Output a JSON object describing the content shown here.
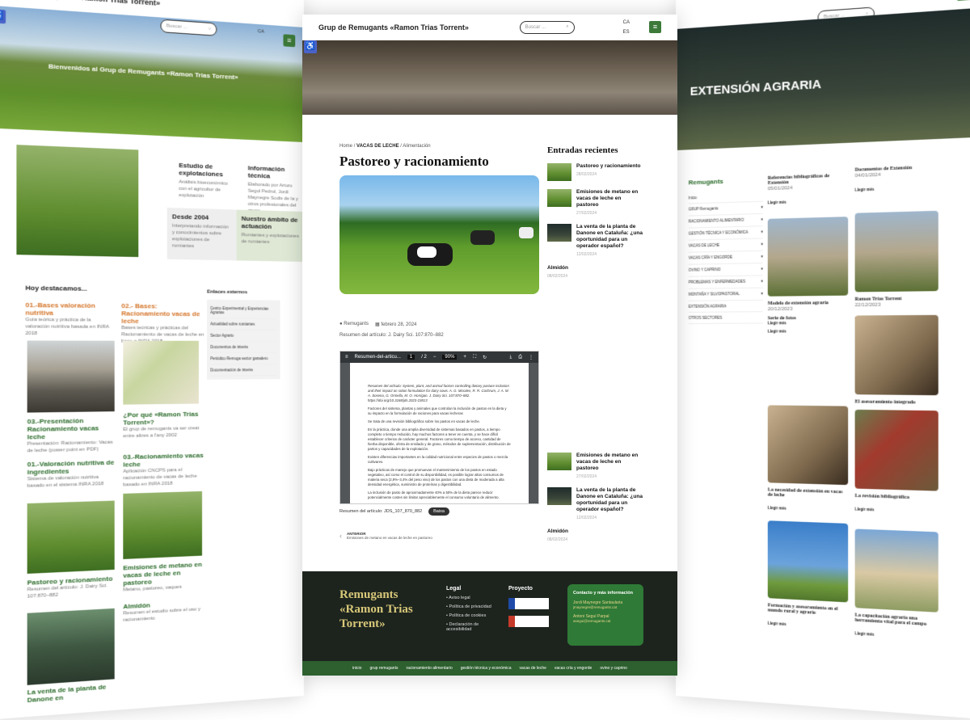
{
  "site": {
    "title": "Grup de Remugants «Ramon Trias Torrent»",
    "search_placeholder": "Buscar ...",
    "lang": "CA",
    "lang_alt": "ES",
    "accent": "#3d7a3a"
  },
  "left": {
    "hero_text": "Bienvenidos al Grup de Remugants «Ramon Trias Torrent»",
    "features": [
      {
        "title": "Estudio de explotaciones",
        "text": "Análisis bioeconómico con el agricultor de explotación"
      },
      {
        "title": "Información técnica",
        "text": "Elaborado por Arturo Segul Pedrol, Jordi Maynegre Sodis de la y otros profesionales del grupo"
      },
      {
        "title": "Desde 2004",
        "text": "Interpretando información y conocimientos sobre explotaciones de rumiantes"
      },
      {
        "title": "Nuestro ámbito de actuación",
        "text": "Rumiantes y explotaciones de rumiantes"
      }
    ],
    "highlights_title": "Hoy destacamos...",
    "links_title": "Enlaces externos",
    "ext_links": [
      "Centro Experimental y Experiencias Agrarias",
      "Actualidad sobre rumiantes",
      "Sector Agrario",
      "Documentos de interés",
      "Periódico Remuga sector ganadero",
      "Documentación de interés"
    ],
    "cards": [
      {
        "title": "01.-Bases valoración nutritiva",
        "text": "Guía teórica y práctica de la valoración nutritiva basada en INRA 2018"
      },
      {
        "title": "02.- Bases: Racionamiento vacas de leche",
        "text": "Bases teóricas y prácticas del Racionamiento de vacas de leche en base a INRA 2018"
      },
      {
        "title": "03.-Presentación Racionamiento vacas leche",
        "text": "Presentación: Racionamiento: Vacas de leche (power point en PDF)"
      },
      {
        "title": "¿Por qué «Ramon Trias Torrent»?",
        "text": "El grup de remugants va ser creat entre altres a l'any 2002"
      },
      {
        "title": "01.-Valoración nutritiva de ingredientes",
        "text": "Sistema de valoración nutritiva basado en el sistema INRA 2018"
      },
      {
        "title": "03.-Racionamiento vacas leche",
        "text": "Aplicación CNCPS para el racionamiento de vacas de leche basado en INRA 2018"
      },
      {
        "title": "Pastoreo y racionamiento",
        "text": "Resumen del artículo: J. Dairy Sci. 107:870–882"
      },
      {
        "title": "Emisiones de metano en vacas de leche en pastoreo",
        "text": "Metano, pastoreo, vaques"
      },
      {
        "title": "Almidón",
        "text": "Resumen el estudio sobre el uso y racionamiento"
      },
      {
        "title": "La venta de la planta de Danone en",
        "text": ""
      }
    ]
  },
  "center": {
    "breadcrumb": {
      "home": "Home",
      "sep": "/",
      "cat": "VACAS DE LECHE",
      "sub": "Alimentación"
    },
    "post_title": "Pastoreo y racionamiento",
    "meta_author": "Remugants",
    "meta_date": "febrero 28, 2024",
    "summary": "Resumen del artículo: J. Dairy Sci. 107:870–882",
    "pdf": {
      "filename": "Resumen-del-articu...",
      "page": "1",
      "pages": "/ 2",
      "zoom": "90%",
      "paragraphs": [
        "Resumen del artículo: System, plant, and animal factors controlling dietary pasture inclusion and their impact on ration formulation for dairy cows. A. G. Morales, R. R. Cochrum, J. A. M. A. Sosena, G. Ormella, M. O. Horrigan. J. Dairy Sci. 107:870–882. https://doi.org/10.3168/jds.2023-23813",
        "Factores del sistema, plantas y animales que controlan la inclusión de pastos en la dieta y su impacto en la formulación de raciones para vacas lecheras",
        "Se trata de una revisión bibliográfica sobre los pastos en vacas de leche.",
        "En la práctica, donde una amplia diversidad de sistemas basados en pastos, a tiempo completo o tiempo reducido, hay muchos factores a tener en cuenta, y se hace difícil establecer criterios de carácter general. Factores como tiempo de acceso, cantidad de hierba disponible, oferta de ensilado y de grano, métodos de suplementación, distribución de partos y capacidades de la explotación.",
        "Existen diferencias importantes en la calidad nutricional entre especies de pastos o mezcla cultivares.",
        "Bajo prácticas de manejo que promuevan el mantenimiento de los pastos en estado vegetativo, así como el control de su disponibilidad, es posible lograr altos consumos de materia seca (2,9%–3,4% del peso vivo) de los pastos con una dieta de moderada a alta densidad energética, suministro de proteínas y digestibilidad.",
        "La inclusión de pasto de aproximadamente 40% a 50% de la dieta parece reducir potencialmente costes sin limitar apreciablemente el consumo voluntario de alimento."
      ]
    },
    "download_label": "Resumen del artículo: JDS_107_870_882",
    "download_btn": "Baixa",
    "prev_label": "ANTERIOR",
    "prev_title": "Emisiones de metano en vacas de leche en pastoreo",
    "recent_title": "Entradas recientes",
    "recent": [
      {
        "title": "Pastoreo y racionamiento",
        "date": "28/02/2024"
      },
      {
        "title": "Emisiones de metano en vacas de leche en pastoreo",
        "date": "27/02/2024"
      },
      {
        "title": "La venta de la planta de Danone en Cataluña: ¿una oportunidad para un operador español?",
        "date": "12/02/2024"
      },
      {
        "title": "Almidón",
        "date": "08/02/2024"
      }
    ],
    "recent_dup": [
      {
        "title": "Emisiones de metano en vacas de leche en pastoreo",
        "date": "27/02/2024"
      },
      {
        "title": "La venta de la planta de Danone en Cataluña: ¿una oportunidad para un operador español?",
        "date": "12/02/2024"
      },
      {
        "title": "Almidón",
        "date": "08/02/2024"
      }
    ],
    "footer": {
      "brand": "Remugants «Ramon Trias Torrent»",
      "legal_title": "Legal",
      "legal_links": [
        "Aviso legal",
        "Política de privacidad",
        "Política de cookies",
        "Declaración de accesibilidad"
      ],
      "project_title": "Proyecto",
      "contact_title": "Contacto y más información",
      "contacts": [
        {
          "name": "Jordi Maynegre Santaularia",
          "email": "jmaynegre@remugants.cat"
        },
        {
          "name": "Antoni Seguí Parpal",
          "email": "asegui@remugants.cat"
        }
      ],
      "nav": [
        "inicio",
        "grup remugants",
        "racionamiento alimentario",
        "gestión técnica y económica",
        "vacas de leche",
        "vacas cría y engorde",
        "ovino y caprino"
      ]
    }
  },
  "right": {
    "hero_text": "EXTENSIÓN AGRARIA",
    "sidebar_title": "Remugants",
    "sidebar_items": [
      "Inicio",
      "GRUP Remugants",
      "RACIONAMIENTO ALIMENTARIO",
      "GESTIÓN TÉCNICA Y ECONÓMICA",
      "VACAS DE LECHE",
      "VACAS CRÍA Y ENGORDE",
      "OVINO Y CAPRINO",
      "PROBLEMAS Y ENFERMEDADES",
      "MONTAÑA Y SILVOPASTORAL",
      "EXTENSIÓN AGRARIA",
      "OTROS SECTORES"
    ],
    "posts": [
      {
        "title": "Referencias bibliográficas de Extensión",
        "date": "05/01/2024",
        "more": "Llegir més"
      },
      {
        "title": "Documentos de Extensión",
        "date": "04/01/2024",
        "more": "Llegir més"
      },
      {
        "title": "Ramon Trias Torrent",
        "date": "22/12/2023",
        "more": "Llegir més"
      },
      {
        "title": "Modelo de extensión agraria",
        "date": "20/12/2023",
        "more": "Llegir més"
      },
      {
        "title": "Serie de fotos",
        "date": "",
        "more": "Llegir més"
      },
      {
        "title": "El asesoramiento integrado",
        "date": "",
        "more": "Llegir més"
      },
      {
        "title": "La necesidad de extensión en vacas de leche",
        "date": "",
        "more": "Llegir més"
      },
      {
        "title": "La revisión bibliográfica",
        "date": "",
        "more": "Llegir més"
      },
      {
        "title": "Formación y asesoramiento en el mundo rural y agrario",
        "date": "",
        "more": "Llegir més"
      },
      {
        "title": "La capacitación agraria una herramienta vital para el campo",
        "date": "",
        "more": "Llegir més"
      }
    ]
  }
}
